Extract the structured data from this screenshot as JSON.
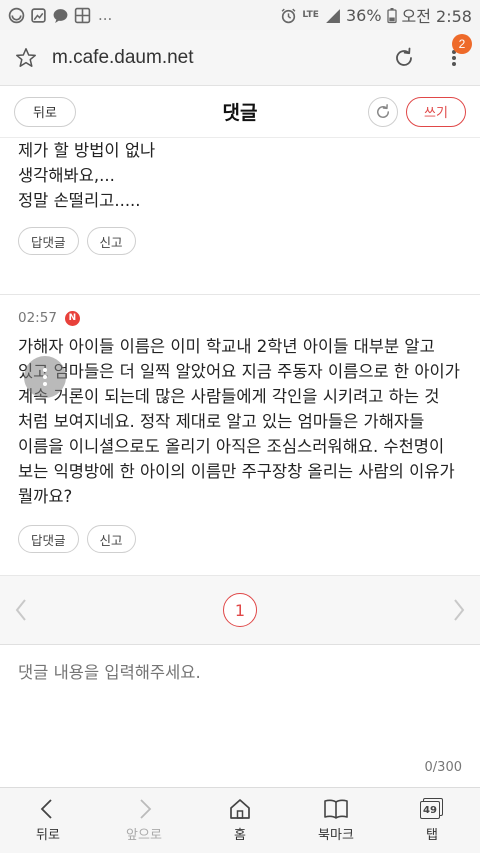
{
  "status_bar": {
    "more": "...",
    "network": "LTE",
    "battery": "36%",
    "time": "오전 2:58",
    "icons": [
      "messenger-icon",
      "gallery-icon",
      "chat-icon",
      "tile-icon",
      "alarm-icon",
      "signal-icon",
      "battery-icon"
    ]
  },
  "browser": {
    "url": "m.cafe.daum.net",
    "tab_badge": "2"
  },
  "header": {
    "back_label": "뒤로",
    "title": "댓글",
    "write_label": "쓰기"
  },
  "comments": [
    {
      "lines": [
        "제가 할 방법이 없나",
        "생각해봐요,...",
        "정말 손떨리고....."
      ],
      "reply_label": "답댓글",
      "report_label": "신고"
    },
    {
      "time": "02:57",
      "new_badge": "N",
      "body": "가해자 아이들 이름은 이미 학교내 2학년 아이들 대부분 알고 있고 엄마들은 더 일찍 알았어요 지금 주동자 이름으로 한 아이가 계속 거론이 되는데 많은 사람들에게 각인을 시키려고 하는 것 처럼 보여지네요. 정작 제대로 알고 있는 엄마들은 가해자들 이름을 이니셜으로도 올리기 아직은 조심스러워해요. 수천명이 보는 익명방에 한 아이의 이름만 주구장창 올리는 사람의 이유가 뭘까요?",
      "reply_label": "답댓글",
      "report_label": "신고"
    }
  ],
  "pager": {
    "current_page": "1"
  },
  "comment_input": {
    "placeholder": "댓글 내용을 입력해주세요.",
    "counter": "0/300"
  },
  "bottom_nav": {
    "back": "뒤로",
    "forward": "앞으로",
    "home": "홈",
    "bookmark": "북마크",
    "tabs": "탭",
    "tab_count": "49"
  },
  "colors": {
    "accent_red": "#e04848",
    "badge_orange": "#ee6a2a"
  }
}
